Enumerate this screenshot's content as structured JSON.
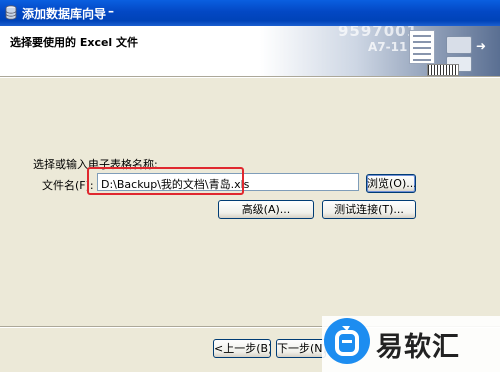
{
  "window": {
    "title": "添加数据库向导",
    "minimize_label": "–"
  },
  "header": {
    "title": "选择要使用的 Excel 文件",
    "banner_text_1": "9597001",
    "banner_text_2": "A7-11"
  },
  "form": {
    "instruction": "选择或输入电子表格名称:",
    "file_label": "文件名(F):",
    "file_value": "D:\\Backup\\我的文档\\青岛.xls",
    "browse_label": "浏览(O)...",
    "advanced_label": "高级(A)...",
    "test_label": "测试连接(T)..."
  },
  "footer": {
    "back_label": "<上一步(B)",
    "next_label": "下一步(N)"
  },
  "watermark": {
    "text": "易软汇",
    "brand_color": "#1d8df0"
  }
}
